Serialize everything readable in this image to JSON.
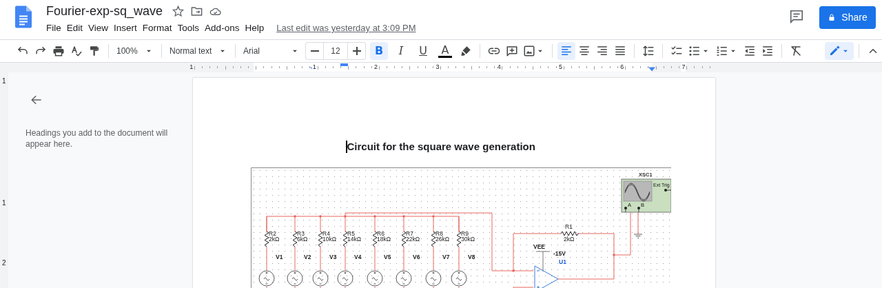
{
  "document": {
    "title": "Fourier-exp-sq_wave"
  },
  "menu": [
    "File",
    "Edit",
    "View",
    "Insert",
    "Format",
    "Tools",
    "Add-ons",
    "Help"
  ],
  "last_edit": "Last edit was yesterday at 3:09 PM",
  "share_button": {
    "label": "Share"
  },
  "toolbar": {
    "zoom": "100%",
    "style": "Normal text",
    "font": "Arial",
    "font_size": "12",
    "format_buttons": [
      {
        "glyph": "B",
        "selected": true
      },
      {
        "glyph": "I",
        "selected": false
      },
      {
        "glyph": "U",
        "selected": false
      }
    ],
    "text_color": {
      "glyph": "A"
    },
    "align_buttons": [
      {
        "selected": true
      },
      {
        "selected": false
      },
      {
        "selected": false
      },
      {
        "selected": false
      }
    ]
  },
  "ruler": {
    "marks": [
      "1",
      "1",
      "2",
      "3",
      "4",
      "5",
      "6",
      "7"
    ]
  },
  "vertical_ruler": {
    "marks": [
      "1",
      "1",
      "2"
    ]
  },
  "outline": {
    "hint": "Headings you add to the document will appear here."
  },
  "page": {
    "heading": "Circuit for the square wave generation",
    "circuit": {
      "resistors": [
        {
          "label": "R2",
          "value": "2kΩ"
        },
        {
          "label": "R3",
          "value": "6kΩ"
        },
        {
          "label": "R4",
          "value": "10kΩ"
        },
        {
          "label": "R5",
          "value": "14kΩ"
        },
        {
          "label": "R6",
          "value": "18kΩ"
        },
        {
          "label": "R7",
          "value": "22kΩ"
        },
        {
          "label": "R8",
          "value": "26kΩ"
        },
        {
          "label": "R9",
          "value": "30kΩ"
        }
      ],
      "sources": [
        "V1",
        "V2",
        "V3",
        "V4",
        "V5",
        "V6",
        "V7",
        "V8"
      ],
      "feedback_resistor": {
        "label": "R1",
        "value": "2kΩ"
      },
      "supply": {
        "label": "VEE",
        "value": "-15V"
      },
      "opamp": {
        "label": "U1"
      },
      "oscilloscope": {
        "label": "XSC1",
        "trigger_label": "Ext Trig",
        "channels": [
          "A",
          "B"
        ]
      }
    }
  }
}
